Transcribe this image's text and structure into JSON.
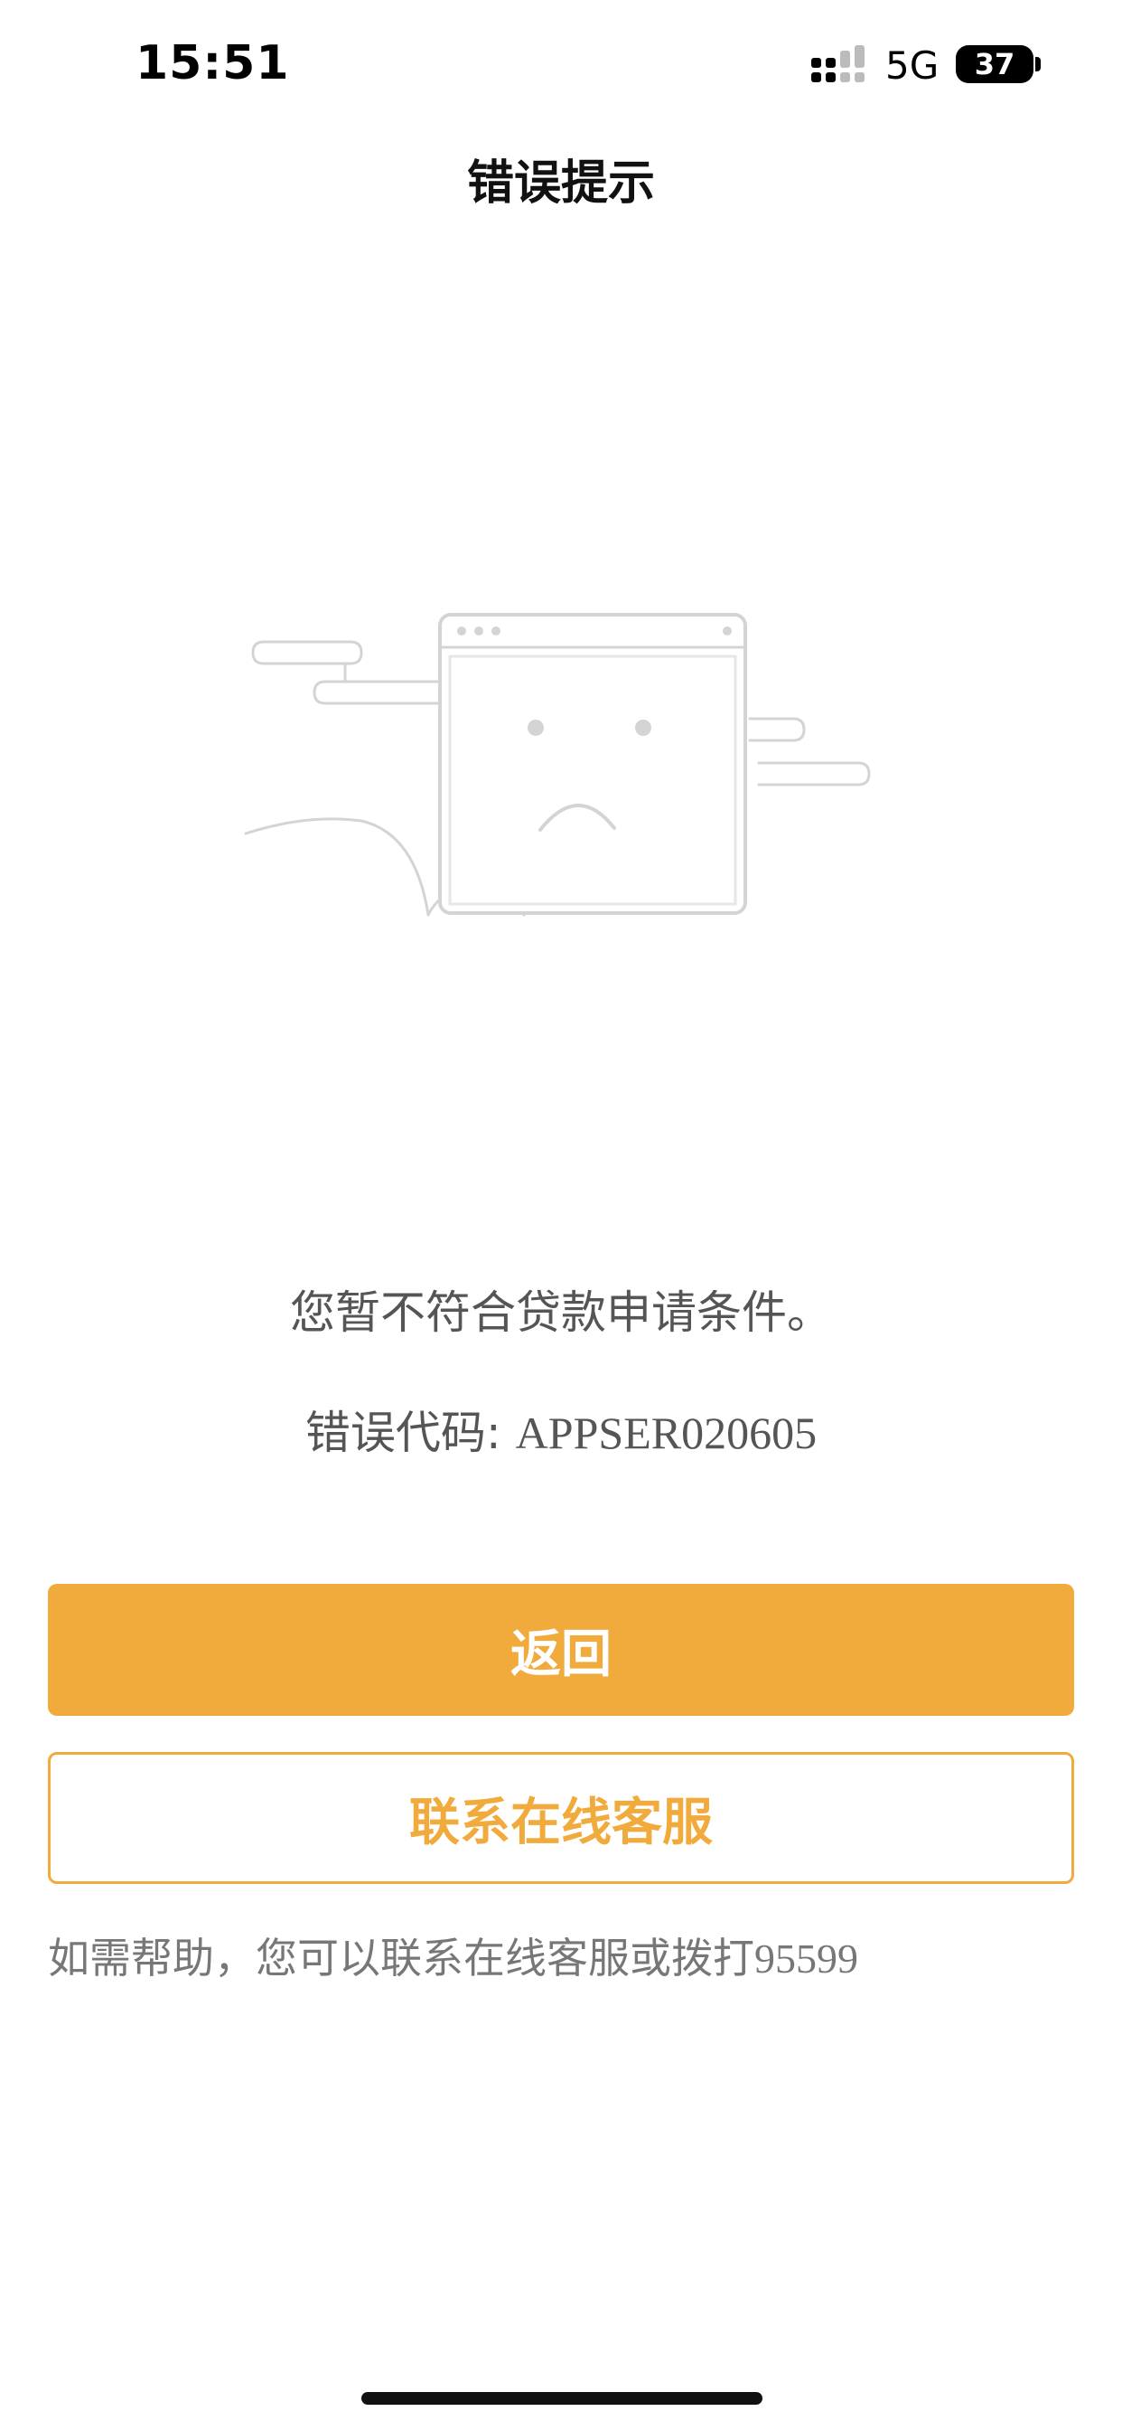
{
  "status_bar": {
    "time": "15:51",
    "network": "5G",
    "battery": "37"
  },
  "nav": {
    "title": "错误提示"
  },
  "illustration": {
    "icon": "sad-browser-window-icon"
  },
  "message": {
    "text": "您暂不符合贷款申请条件。",
    "error_code_label": "错误代码: ",
    "error_code": "APPSER020605"
  },
  "buttons": {
    "back_label": "返回",
    "contact_label": "联系在线客服"
  },
  "help": {
    "text": "如需帮助，您可以联系在线客服或拨打",
    "phone": "95599"
  },
  "colors": {
    "accent": "#f0ab3c",
    "text_secondary": "#555555",
    "illustration_stroke": "#d4d4d4"
  }
}
